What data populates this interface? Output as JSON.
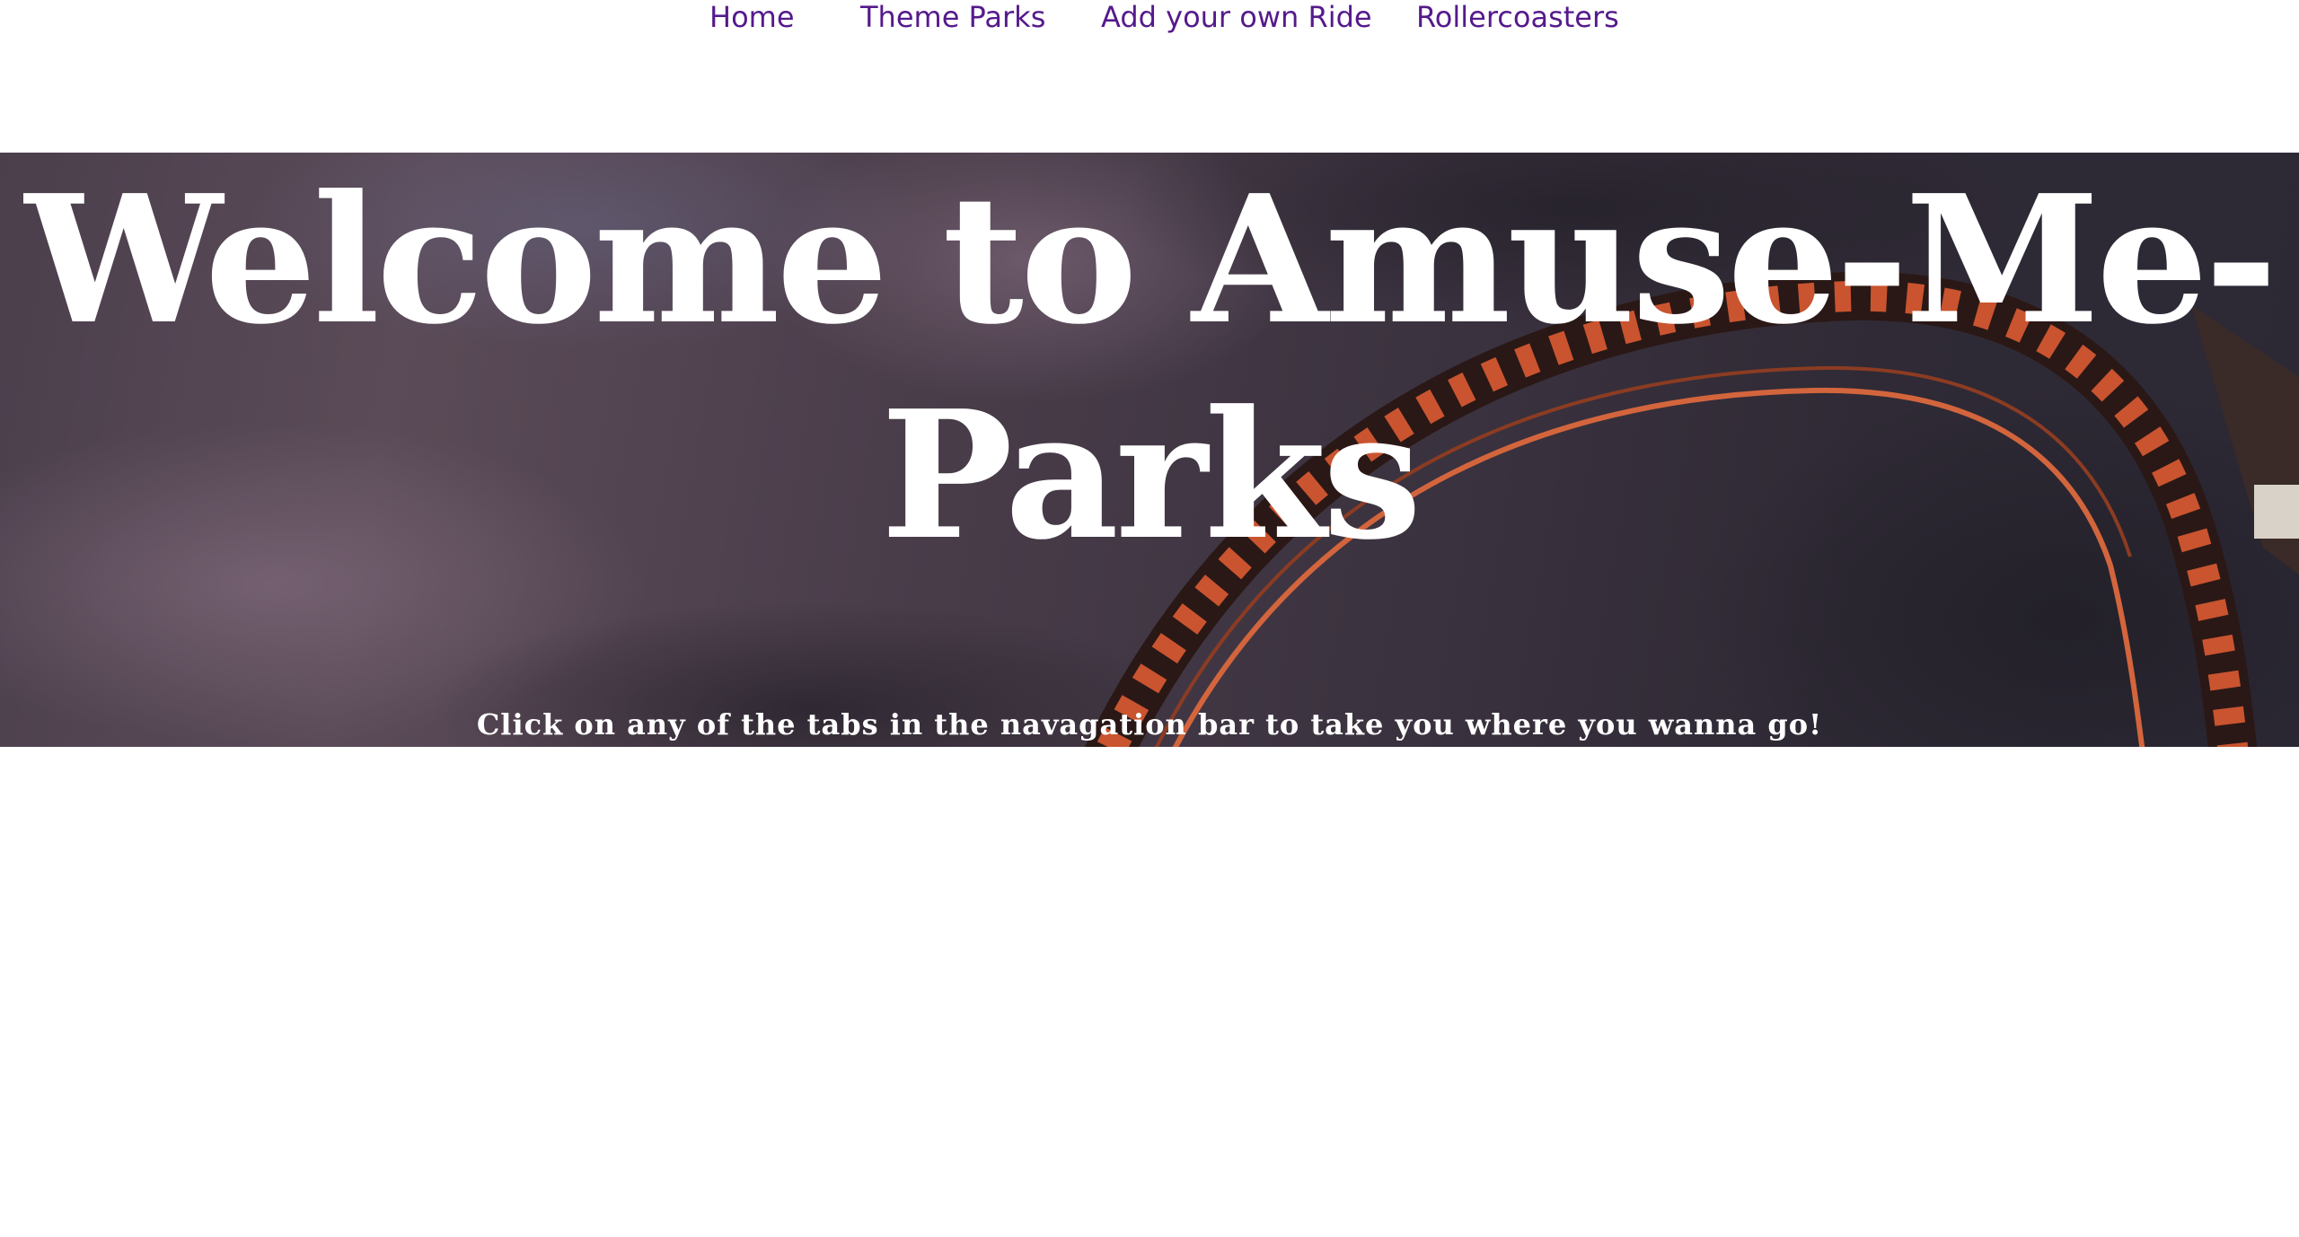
{
  "nav": {
    "items": [
      {
        "label": "Home"
      },
      {
        "label": "Theme Parks"
      },
      {
        "label": "Add your own Ride"
      },
      {
        "label": "Rollercoasters"
      }
    ]
  },
  "hero": {
    "title": "Welcome to Amuse-Me-Parks",
    "subtitle": "Click on any of the tabs in the navagation bar to take you where you wanna go!"
  },
  "colors": {
    "link": "#551a8b",
    "coaster_track": "#e0603a",
    "hero_text": "#ffffff"
  }
}
